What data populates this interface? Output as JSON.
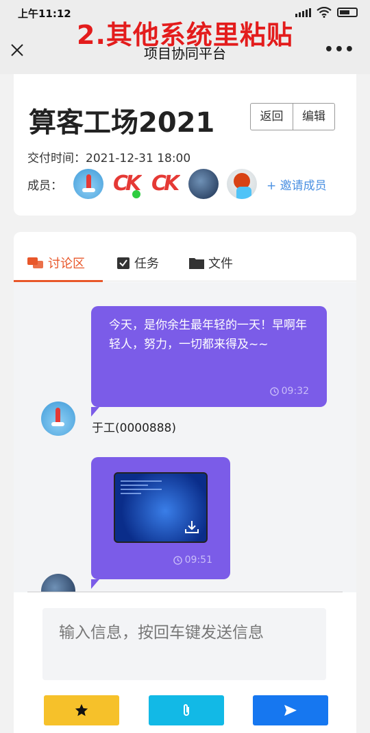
{
  "status": {
    "time": "上午11:12"
  },
  "overlay": {
    "text": "2.其他系统里粘贴"
  },
  "nav": {
    "title": "项目协同平台",
    "more": "•••"
  },
  "project": {
    "title": "算客工场2021",
    "back_label": "返回",
    "edit_label": "编辑",
    "deliver_label": "交付时间：",
    "deliver_value": "2021-12-31 18:00",
    "members_label": "成员：",
    "invite_label": "+ 邀请成员"
  },
  "tabs": [
    {
      "label": "讨论区",
      "icon": "chat-bubbles-icon",
      "active": true
    },
    {
      "label": "任务",
      "icon": "checklist-icon",
      "active": false
    },
    {
      "label": "文件",
      "icon": "folder-icon",
      "active": false
    }
  ],
  "messages": [
    {
      "text": "今天，是你余生最年轻的一天！早啊年轻人，努力，一切都来得及~~",
      "time": "09:32",
      "sender": "于工(0000888)"
    },
    {
      "type": "image",
      "time": "09:51"
    }
  ],
  "composer": {
    "placeholder": "输入信息，按回车键发送信息"
  },
  "colors": {
    "accent": "#e8572a",
    "bubble": "#7b5ce8",
    "invite": "#4a90e2",
    "star_btn": "#f6c12a",
    "clip_btn": "#12b9e6",
    "send_btn": "#1677f0",
    "overlay": "#e31c1c"
  }
}
